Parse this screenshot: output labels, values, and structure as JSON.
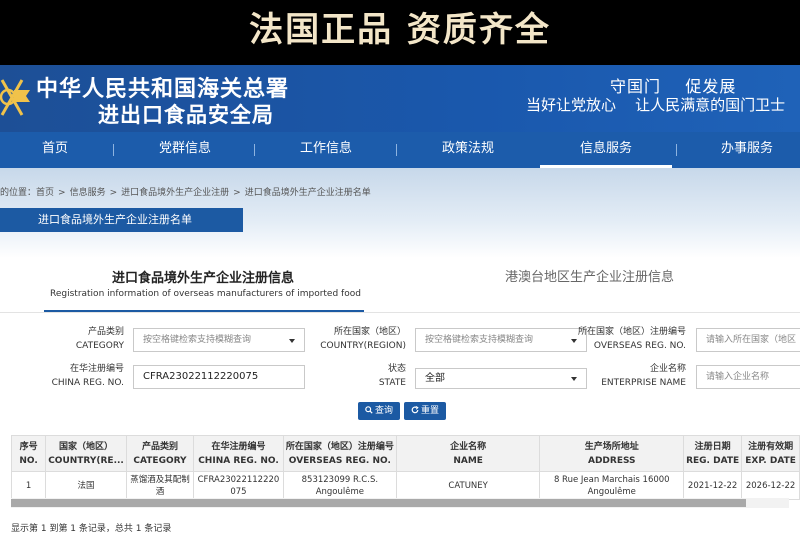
{
  "banner": {
    "title": "法国正品 资质齐全"
  },
  "header": {
    "agency_name": "中华人民共和国海关总署",
    "bureau_name": "进出口食品安全局",
    "slogan_line1": "守国门    促发展",
    "slogan_line2": "当好让党放心    让人民满意的国门卫士"
  },
  "nav": {
    "items": [
      "首页",
      "党群信息",
      "工作信息",
      "政策法规",
      "信息服务",
      "办事服务"
    ],
    "active_index": 4
  },
  "breadcrumb": {
    "prefix": "的位置：",
    "items": [
      "首页",
      ">",
      "信息服务",
      ">",
      "进口食品境外生产企业注册",
      ">",
      "进口食品境外生产企业注册名单"
    ]
  },
  "page_tab": {
    "label": "进口食品境外生产企业注册名单"
  },
  "section": {
    "title_cn": "进口食品境外生产企业注册信息",
    "title_en": "Registration information of overseas manufacturers of imported food",
    "other_tab": "港澳台地区生产企业注册信息"
  },
  "form": {
    "category": {
      "label_cn": "产品类别",
      "label_en": "CATEGORY",
      "placeholder": "按空格键检索支持模糊查询"
    },
    "country": {
      "label_cn": "所在国家（地区）",
      "label_en": "COUNTRY(REGION)",
      "placeholder": "按空格键检索支持模糊查询"
    },
    "overseas_reg": {
      "label_cn": "所在国家（地区）注册编号",
      "label_en": "OVERSEAS REG. NO.",
      "placeholder": "请输入所在国家（地区"
    },
    "china_reg": {
      "label_cn": "在华注册编号",
      "label_en": "CHINA REG. NO.",
      "value": "CFRA23022112220075"
    },
    "state": {
      "label_cn": "状态",
      "label_en": "STATE",
      "value": "全部"
    },
    "enterprise": {
      "label_cn": "企业名称",
      "label_en": "ENTERPRISE NAME",
      "placeholder": "请输入企业名称"
    },
    "search_label": "查询",
    "reset_label": "重置"
  },
  "table": {
    "headers": [
      {
        "cn": "序号",
        "en": "NO."
      },
      {
        "cn": "国家（地区）",
        "en": "COUNTRY(RE..."
      },
      {
        "cn": "产品类别",
        "en": "CATEGORY"
      },
      {
        "cn": "在华注册编号",
        "en": "CHINA REG. NO."
      },
      {
        "cn": "所在国家（地区）注册编号",
        "en": "OVERSEAS REG. NO."
      },
      {
        "cn": "企业名称",
        "en": "NAME"
      },
      {
        "cn": "生产场所地址",
        "en": "ADDRESS"
      },
      {
        "cn": "注册日期",
        "en": "REG. DATE"
      },
      {
        "cn": "注册有效期",
        "en": "EXP. DATE"
      }
    ],
    "rows": [
      {
        "no": "1",
        "country": "法国",
        "category": "蒸馏酒及其配制酒",
        "china_reg": "CFRA23022112220075",
        "overseas_reg": "853123099 R.C.S. Angoulême",
        "name": "CATUNEY",
        "address": "8 Rue Jean Marchais 16000 Angoulême",
        "reg_date": "2021-12-22",
        "exp_date": "2026-12-22"
      }
    ]
  },
  "footer": {
    "record_count": "显示第 1 到第 1 条记录，总共 1 条记录"
  },
  "colors": {
    "nav_blue": "#1c5cab",
    "banner_text": "#f3e6c8"
  }
}
